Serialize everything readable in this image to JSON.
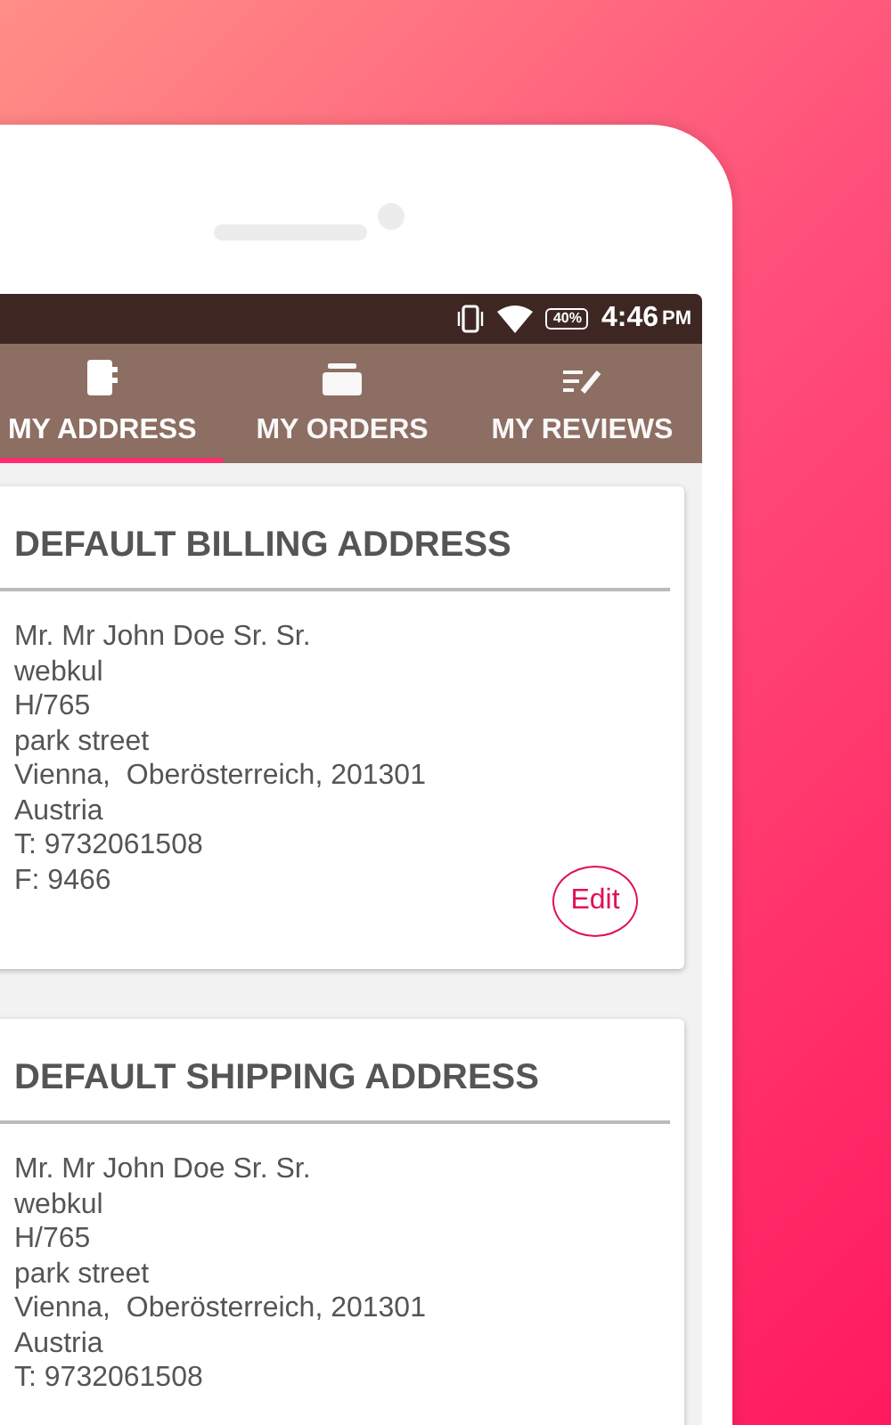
{
  "status_bar": {
    "battery": "40%",
    "time": "4:46",
    "period": "PM"
  },
  "tabs": [
    {
      "label": "MY ADDRESS",
      "selected": true
    },
    {
      "label": "MY ORDERS",
      "selected": false
    },
    {
      "label": "MY REVIEWS",
      "selected": false
    }
  ],
  "cards": [
    {
      "title": "DEFAULT BILLING ADDRESS",
      "lines": [
        "Mr. Mr John Doe Sr. Sr.",
        "webkul",
        "H/765",
        "park street",
        "Vienna,  Oberösterreich, 201301",
        "Austria",
        "T: 9732061508",
        "F: 9466"
      ],
      "button": "Edit"
    },
    {
      "title": "DEFAULT SHIPPING ADDRESS",
      "lines": [
        "Mr. Mr John Doe Sr. Sr.",
        "webkul",
        "H/765",
        "park street",
        "Vienna,  Oberösterreich, 201301",
        "Austria",
        "T: 9732061508"
      ]
    }
  ]
}
